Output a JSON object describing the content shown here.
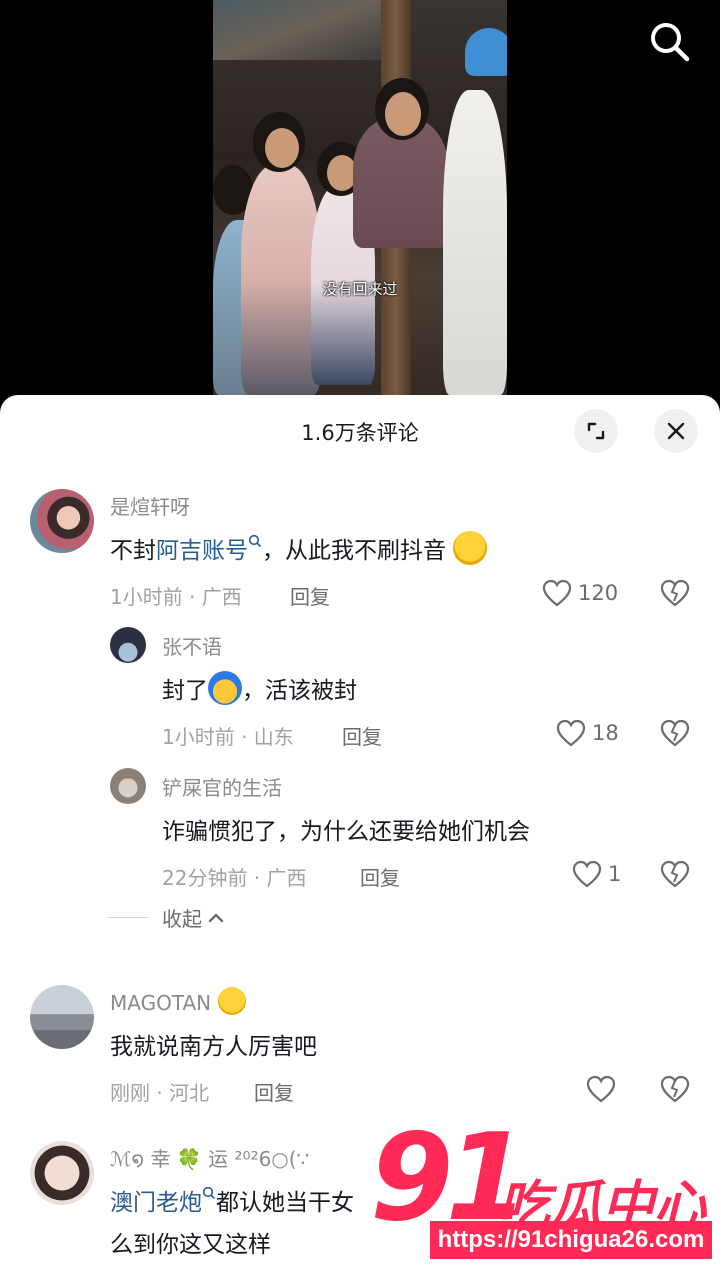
{
  "video": {
    "caption": "没有回来过"
  },
  "sheet": {
    "title": "1.6万条评论"
  },
  "comments": [
    {
      "username": "是煊轩呀",
      "text_prefix": "不封",
      "mention": "阿吉账号",
      "text_suffix": "，从此我不刷抖音",
      "time_location": "1小时前 · 广西",
      "reply_label": "回复",
      "likes": "120"
    },
    {
      "username": "张不语",
      "text_prefix": "封了",
      "text_suffix": "，活该被封",
      "time_location": "1小时前 · 山东",
      "reply_label": "回复",
      "likes": "18"
    },
    {
      "username": "铲屎官的生活",
      "text": "诈骗惯犯了，为什么还要给她们机会",
      "time_location": "22分钟前 · 广西",
      "reply_label": "回复",
      "likes": "1"
    },
    {
      "username": "MAGOTAN",
      "text": "我就说南方人厉害吧",
      "time_location": "刚刚 · 河北",
      "reply_label": "回复",
      "likes": ""
    },
    {
      "username": "ℳ໑ 幸 🍀 运 ²⁰²6○(∵",
      "mention": "澳门老炮",
      "text_suffix": "都认她当干女",
      "text_line2": "么到你这又这样"
    }
  ],
  "collapse": {
    "label": "收起"
  },
  "watermark": {
    "number": "91",
    "name": "吃瓜中心",
    "url": "https://91chigua26.com"
  },
  "colors": {
    "accent_mention": "#2a5c94",
    "watermark": "#ff2a55"
  }
}
